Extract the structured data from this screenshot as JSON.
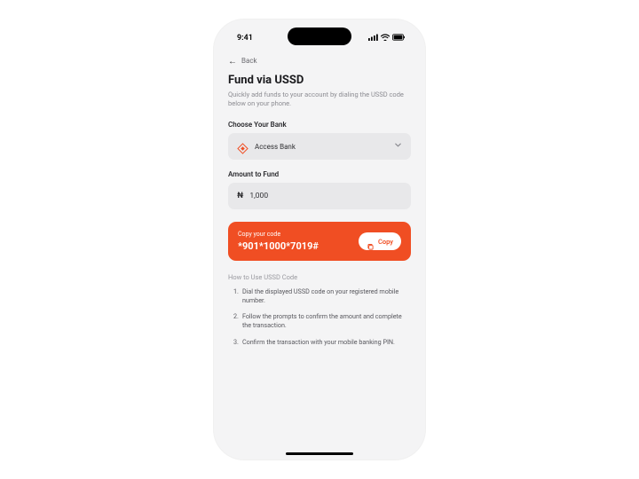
{
  "status": {
    "time": "9:41"
  },
  "nav": {
    "back": "Back"
  },
  "header": {
    "title": "Fund via USSD",
    "subtitle": "Quickly add funds to your account by dialing the USSD code below on your phone."
  },
  "bank": {
    "label": "Choose Your Bank",
    "selected": "Access Bank"
  },
  "amount": {
    "label": "Amount to Fund",
    "currency": "₦",
    "value": "1,000"
  },
  "code": {
    "label": "Copy your code",
    "value": "*901*1000*7019#",
    "copy_btn": "Copy"
  },
  "howto": {
    "title": "How to Use USSD Code",
    "steps": [
      "Dial the displayed USSD code on your registered mobile number.",
      "Follow the prompts to confirm the amount and complete the transaction.",
      "Confirm the transaction with your mobile banking PIN."
    ]
  },
  "colors": {
    "accent": "#f04e23"
  }
}
